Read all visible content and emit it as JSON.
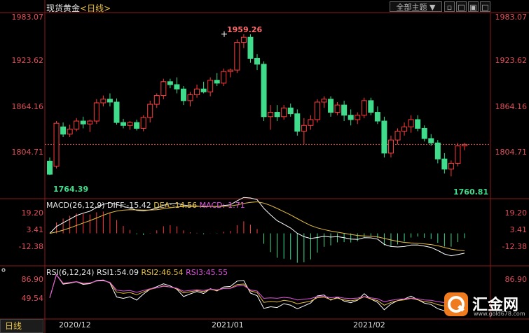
{
  "header": {
    "title": "现货黄金",
    "timeframe": "<日线>",
    "theme_button": "全部主题",
    "theme_arrow": "▼"
  },
  "price_axis": {
    "labels": [
      "1983.07",
      "1923.62",
      "1864.16",
      "1804.71"
    ]
  },
  "annotations": {
    "high": "1959.26",
    "low_left": "1764.39",
    "low_right": "1760.81"
  },
  "macd": {
    "legend": "MACD(26,12,9)",
    "diff": "DIFF:-15.42",
    "dea": "DEA:-14.56",
    "macd": "MACD:-1.71",
    "axis": [
      "19.20",
      "3.41",
      "-12.38"
    ]
  },
  "rsi": {
    "legend": "RSI(6,12,24)",
    "rsi1": "RSI1:54.09",
    "rsi2": "RSI2:46.54",
    "rsi3": "RSI3:45.55",
    "axis": [
      "86.90",
      "49.54"
    ]
  },
  "x_axis": {
    "labels": [
      "2020/12",
      "2021/01",
      "2021/02"
    ]
  },
  "bottom_tab": "日线",
  "logo": {
    "text": "汇金网",
    "url": "www.gold678.com"
  },
  "colors": {
    "up": "#ff3b3b",
    "down": "#3fdc8c",
    "accent": "#e8c040",
    "axis": "#e0505a"
  },
  "candles": [
    [
      1785,
      1790,
      1766,
      1767
    ],
    [
      1778,
      1840,
      1775,
      1837
    ],
    [
      1832,
      1838,
      1818,
      1822
    ],
    [
      1822,
      1835,
      1818,
      1829
    ],
    [
      1829,
      1844,
      1826,
      1840
    ],
    [
      1840,
      1846,
      1830,
      1836
    ],
    [
      1836,
      1842,
      1825,
      1840
    ],
    [
      1840,
      1870,
      1836,
      1865
    ],
    [
      1865,
      1875,
      1860,
      1870
    ],
    [
      1870,
      1878,
      1860,
      1866
    ],
    [
      1866,
      1871,
      1835,
      1838
    ],
    [
      1838,
      1843,
      1830,
      1834
    ],
    [
      1834,
      1840,
      1828,
      1838
    ],
    [
      1838,
      1842,
      1827,
      1830
    ],
    [
      1830,
      1848,
      1826,
      1845
    ],
    [
      1845,
      1868,
      1838,
      1863
    ],
    [
      1863,
      1878,
      1858,
      1875
    ],
    [
      1875,
      1898,
      1870,
      1894
    ],
    [
      1894,
      1898,
      1885,
      1890
    ],
    [
      1890,
      1900,
      1878,
      1884
    ],
    [
      1884,
      1888,
      1862,
      1868
    ],
    [
      1868,
      1880,
      1860,
      1876
    ],
    [
      1876,
      1890,
      1872,
      1884
    ],
    [
      1884,
      1894,
      1878,
      1880
    ],
    [
      1880,
      1900,
      1874,
      1896
    ],
    [
      1896,
      1906,
      1888,
      1892
    ],
    [
      1892,
      1912,
      1888,
      1908
    ],
    [
      1908,
      1912,
      1900,
      1910
    ],
    [
      1910,
      1952,
      1906,
      1948
    ],
    [
      1948,
      1959,
      1940,
      1955
    ],
    [
      1955,
      1959,
      1920,
      1926
    ],
    [
      1926,
      1932,
      1910,
      1918
    ],
    [
      1918,
      1922,
      1840,
      1846
    ],
    [
      1846,
      1862,
      1828,
      1852
    ],
    [
      1852,
      1862,
      1840,
      1846
    ],
    [
      1846,
      1862,
      1842,
      1858
    ],
    [
      1858,
      1864,
      1846,
      1850
    ],
    [
      1850,
      1856,
      1820,
      1826
    ],
    [
      1826,
      1844,
      1808,
      1834
    ],
    [
      1834,
      1848,
      1828,
      1842
    ],
    [
      1842,
      1870,
      1838,
      1866
    ],
    [
      1866,
      1874,
      1858,
      1870
    ],
    [
      1870,
      1874,
      1846,
      1852
    ],
    [
      1852,
      1866,
      1848,
      1862
    ],
    [
      1862,
      1868,
      1840,
      1848
    ],
    [
      1848,
      1856,
      1834,
      1842
    ],
    [
      1842,
      1852,
      1836,
      1848
    ],
    [
      1848,
      1872,
      1844,
      1868
    ],
    [
      1868,
      1872,
      1848,
      1852
    ],
    [
      1852,
      1860,
      1836,
      1840
    ],
    [
      1840,
      1846,
      1790,
      1796
    ],
    [
      1796,
      1820,
      1790,
      1814
    ],
    [
      1814,
      1830,
      1808,
      1826
    ],
    [
      1826,
      1838,
      1820,
      1832
    ],
    [
      1832,
      1848,
      1824,
      1842
    ],
    [
      1842,
      1848,
      1826,
      1830
    ],
    [
      1830,
      1834,
      1812,
      1816
    ],
    [
      1816,
      1822,
      1806,
      1810
    ],
    [
      1810,
      1814,
      1782,
      1788
    ],
    [
      1788,
      1796,
      1768,
      1774
    ],
    [
      1774,
      1786,
      1764,
      1782
    ],
    [
      1782,
      1810,
      1778,
      1806
    ],
    [
      1806,
      1810,
      1800,
      1808
    ]
  ]
}
